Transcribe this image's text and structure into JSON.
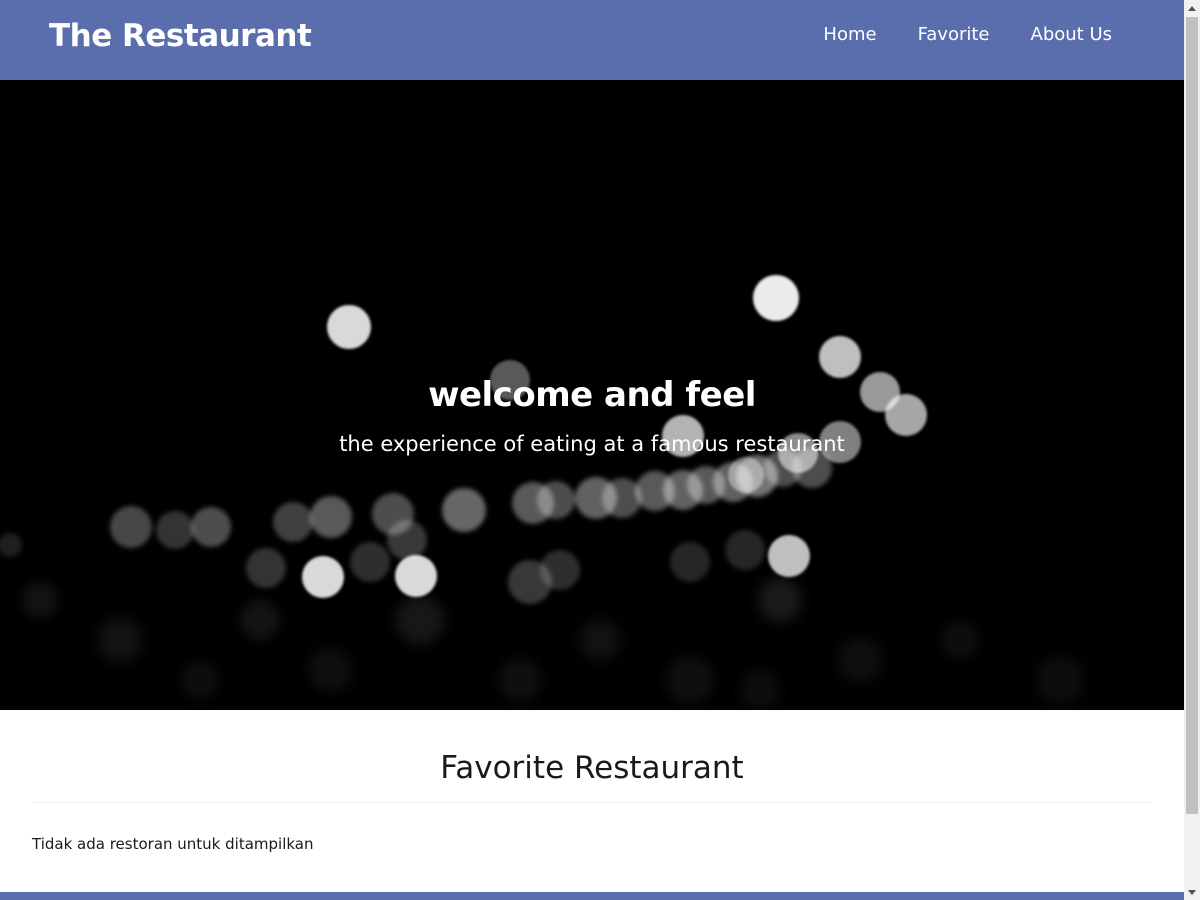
{
  "header": {
    "brand": "The Restaurant",
    "nav": [
      {
        "label": "Home"
      },
      {
        "label": "Favorite"
      },
      {
        "label": "About Us"
      }
    ],
    "background_color": "#5a6dad"
  },
  "hero": {
    "title": "welcome and feel",
    "subtitle": "the experience of eating at a famous restaurant",
    "image": "bokeh-lights-background"
  },
  "main": {
    "section_title": "Favorite Restaurant",
    "empty_message": "Tidak ada restoran untuk ditampilkan"
  },
  "scrollbar": {
    "up_icon": "scroll-up-arrow-icon",
    "down_icon": "scroll-down-arrow-icon"
  }
}
